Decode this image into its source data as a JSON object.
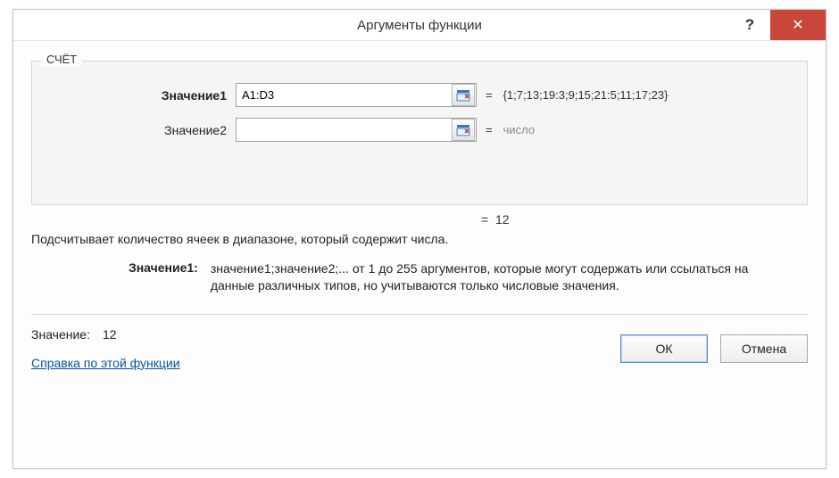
{
  "titlebar": {
    "title": "Аргументы функции",
    "help_symbol": "?",
    "close_symbol": "✕"
  },
  "group": {
    "legend": "СЧЁТ",
    "args": [
      {
        "label": "Значение1",
        "required": true,
        "value": "A1:D3",
        "result": "{1;7;13;19:3;9;15;21:5;11;17;23}"
      },
      {
        "label": "Значение2",
        "required": false,
        "value": "",
        "result_placeholder": "число"
      }
    ]
  },
  "middle": {
    "equals": "=",
    "value": "12"
  },
  "description": "Подсчитывает количество ячеек в диапазоне, который содержит числа.",
  "arg_help": {
    "label": "Значение1:",
    "text": "значение1;значение2;... от 1 до 255 аргументов, которые могут содержать или ссылаться на данные различных типов, но учитываются только числовые значения."
  },
  "footer": {
    "result_label": "Значение:",
    "result_value": "12",
    "help_link": "Справка по этой функции",
    "ok": "ОК",
    "cancel": "Отмена"
  }
}
